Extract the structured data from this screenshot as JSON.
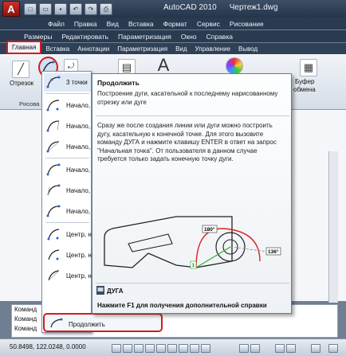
{
  "titlebar": {
    "app_logo": "A",
    "app_name": "AutoCAD 2010",
    "file_name": "Чертеж1.dwg",
    "qat_buttons": [
      "new-icon",
      "open-icon",
      "save-icon",
      "undo-icon",
      "redo-icon",
      "plot-icon"
    ]
  },
  "menu_row1": [
    "Файл",
    "Правка",
    "Вид",
    "Вставка",
    "Формат",
    "Сервис",
    "Рисование"
  ],
  "menu_row2": [
    "Размеры",
    "Редактировать",
    "Параметризация",
    "Окно",
    "Справка"
  ],
  "ribbon_tabs": [
    "Главная",
    "Вставка",
    "Аннотации",
    "Параметризация",
    "Вид",
    "Управление",
    "Вывод"
  ],
  "ribbon": {
    "line_label": "Отрезок",
    "draw_panel_title": "Рисова",
    "clipboard_label": "Буфер",
    "clipboard_label2": "обмена"
  },
  "dropdown": {
    "items": [
      {
        "label": "3 точки",
        "icon": "arc-3points-icon"
      },
      {
        "label": "Начало,",
        "icon": "arc-start-center-end-icon"
      },
      {
        "label": "Начало,",
        "icon": "arc-start-center-angle-icon"
      },
      {
        "label": "Начало,",
        "icon": "arc-start-center-length-icon"
      },
      {
        "label": "Начало,",
        "icon": "arc-start-end-angle-icon"
      },
      {
        "label": "Начало,",
        "icon": "arc-start-end-direction-icon"
      },
      {
        "label": "Начало,",
        "icon": "arc-start-end-radius-icon"
      },
      {
        "label": "Центр, н",
        "icon": "arc-center-start-end-icon"
      },
      {
        "label": "Центр, н",
        "icon": "arc-center-start-angle-icon"
      },
      {
        "label": "Центр, н",
        "icon": "arc-center-start-length-icon"
      }
    ]
  },
  "tooltip": {
    "title": "Продолжить",
    "summary": "Построение дуги, касательной к последнему нарисованному отрезку или дуге",
    "detail": "Сразу же после создания линии или дуги можно построить дугу, касательную к конечной точке. Для этого вызовите команду ДУГА и нажмите клавишу ENTER в ответ на запрос \"Начальная точка\". От пользователя в данном случае требуется только задать конечную точку дуги.",
    "figure_labels": [
      "180°",
      "136°",
      "1"
    ],
    "command_name": "ДУГА",
    "help_hint": "Нажмите F1 для получения дополнительной справки"
  },
  "continue_item": {
    "label": "Продолжить",
    "icon": "arc-continue-icon"
  },
  "command_line": [
    "Команд",
    "Команд",
    "Команд"
  ],
  "status": {
    "coords": "50.8498, 122.0248, 0.0000"
  },
  "colors": {
    "highlight": "#d61a1a",
    "titlebar": "#2a3a50",
    "ribbon": "#e5eaf0"
  }
}
